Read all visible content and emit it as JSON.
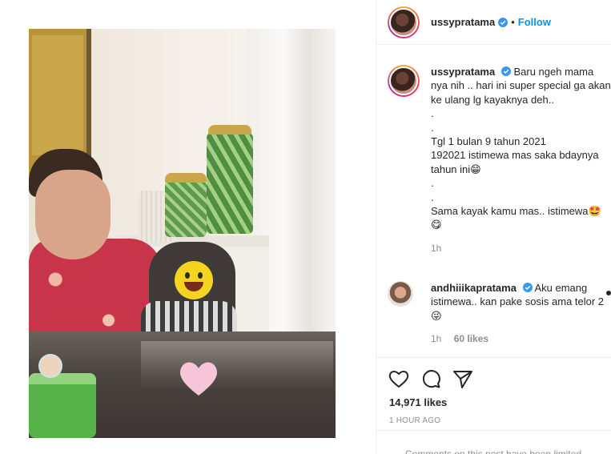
{
  "post": {
    "author": {
      "username": "ussypratama",
      "verified": true,
      "follow_label": "Follow",
      "separator": "•"
    },
    "caption": {
      "username": "ussypratama",
      "lines": [
        "Baru ngeh mama nya nih .. hari ini super special ga akan ke ulang lg kayaknya deh..",
        ".",
        ".",
        "Tgl 1 bulan 9 tahun 2021",
        "192021 istimewa mas saka bdaynya tahun ini😁",
        ".",
        ".",
        "Sama kayak kamu mas.. istimewa🤩",
        "😋"
      ],
      "time": "1h"
    },
    "comments": [
      {
        "username": "andhiiikapratama",
        "verified": true,
        "text": "Aku emang istimewa.. kan pake sosis ama telor 2 😜",
        "time": "1h",
        "likes": "60 likes"
      }
    ],
    "likes_count": "14,971 likes",
    "timestamp": "1 HOUR AGO",
    "comments_notice": "Comments on this post have been limited.",
    "icons": [
      "heart-icon",
      "comment-icon",
      "share-icon",
      "verified-icon"
    ],
    "colors": {
      "link": "#0095f6",
      "verified": "#3897f0",
      "muted": "#8e8e8e",
      "text": "#262626"
    }
  }
}
